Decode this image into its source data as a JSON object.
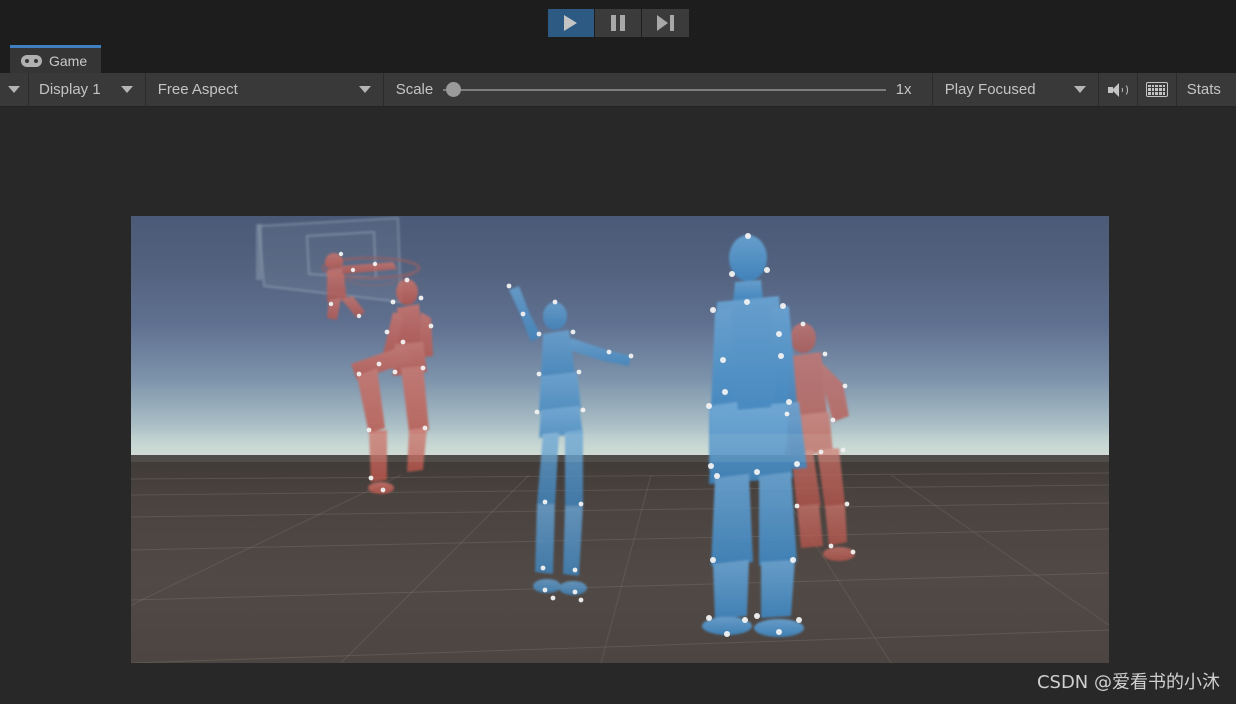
{
  "window": {
    "background_color": "#282828"
  },
  "playbar": {
    "buttons": [
      {
        "name": "play",
        "label": "Play",
        "icon": "play-icon",
        "active": true
      },
      {
        "name": "pause",
        "label": "Pause",
        "icon": "pause-icon",
        "active": false
      },
      {
        "name": "step",
        "label": "Step",
        "icon": "step-icon",
        "active": false
      }
    ],
    "active_color": "#2d5a82"
  },
  "tabs": [
    {
      "label": "Game",
      "icon": "gamepad-icon",
      "active": true
    }
  ],
  "toolbar": {
    "display_caret_icon": "chevron-down-icon",
    "display": {
      "label": "Display 1",
      "caret_icon": "chevron-down-icon"
    },
    "aspect": {
      "label": "Free Aspect",
      "caret_icon": "chevron-down-icon"
    },
    "scale": {
      "label": "Scale",
      "value": "1x",
      "slider_position_percent": 0
    },
    "focus": {
      "label": "Play Focused",
      "caret_icon": "chevron-down-icon"
    },
    "mute_audio_icon": "speaker-icon",
    "gizmos_icon": "keyboard-icon",
    "stats": {
      "label": "Stats"
    }
  },
  "game_view": {
    "scene_name": "basketball-motion-capture-scene",
    "sky_top_color": "#4a5a77",
    "sky_horizon_color": "#cfdad4",
    "ground_color": "#4a4340",
    "objects": [
      {
        "name": "basketball-hoop",
        "type": "backboard-and-rim",
        "color": "#b8c6d4"
      },
      {
        "name": "mannequin-red-dunking",
        "type": "humanoid",
        "color": "#c4584f"
      },
      {
        "name": "mannequin-red-seated",
        "type": "humanoid",
        "color": "#c4584f"
      },
      {
        "name": "mannequin-blue-arms-out",
        "type": "humanoid",
        "color": "#4a8fc7"
      },
      {
        "name": "mannequin-blue-standing",
        "type": "humanoid",
        "color": "#4a8fc7"
      },
      {
        "name": "mannequin-red-crouching",
        "type": "humanoid",
        "color": "#c4584f"
      }
    ]
  },
  "watermark": {
    "text": "CSDN @爱看书的小沐"
  }
}
